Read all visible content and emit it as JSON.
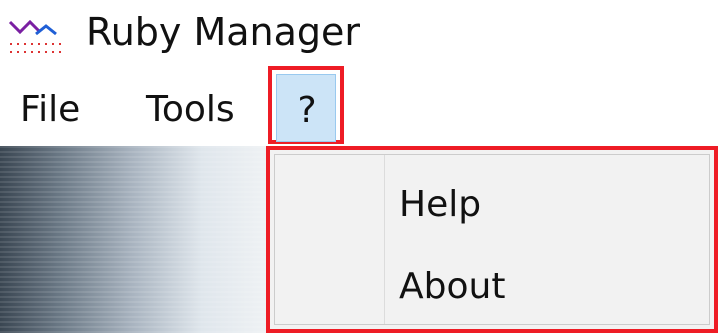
{
  "window": {
    "title": "Ruby Manager"
  },
  "menubar": {
    "items": [
      {
        "label": "File"
      },
      {
        "label": "Tools"
      },
      {
        "label": "?"
      }
    ],
    "highlight_color": "#cce4f7",
    "annotation_color": "#ee1c25"
  },
  "dropdown": {
    "items": [
      {
        "label": "Help"
      },
      {
        "label": "About"
      }
    ]
  },
  "icons": {
    "app": "chart-line-icon"
  }
}
